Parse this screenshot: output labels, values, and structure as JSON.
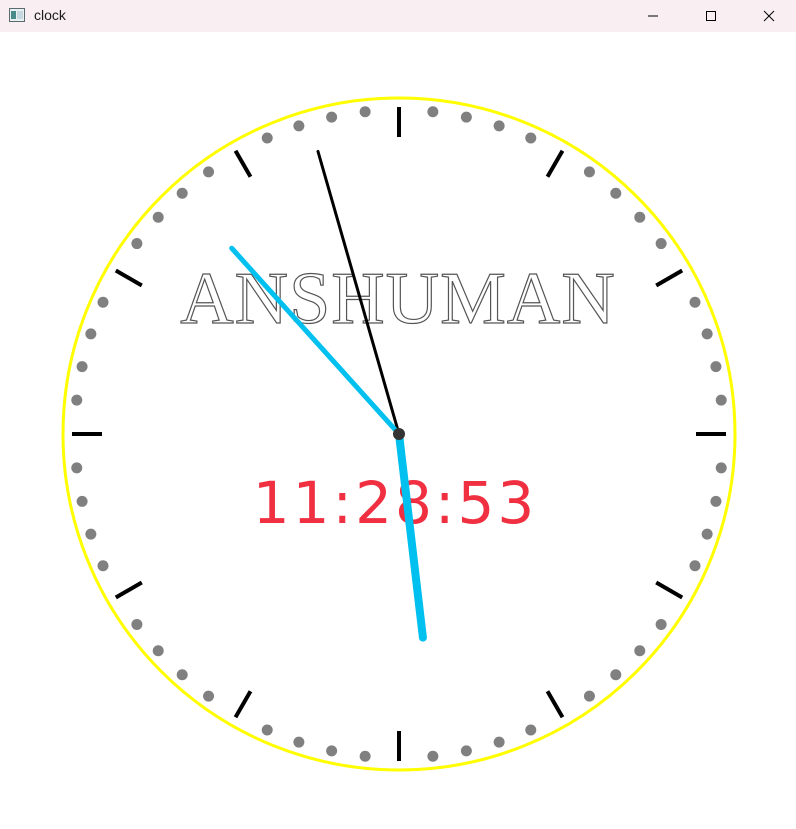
{
  "window": {
    "title": "clock",
    "icons": {
      "app": "app-window-icon",
      "minimize": "minimize-icon",
      "maximize": "maximize-icon",
      "close": "close-icon"
    }
  },
  "clock": {
    "name_text": "ANSHUMAN",
    "digital_time": "11:28:53",
    "time": {
      "hours": 11,
      "minutes": 28,
      "seconds": 53
    },
    "colors": {
      "rim": "#ffff00",
      "hour_marks": "#000000",
      "minute_dots": "#808080",
      "hour_hand": "#000000",
      "minute_hand": "#00c0f0",
      "second_hand": "#00c0f0",
      "center_dot": "#333333",
      "digital_text": "#f03040",
      "name_text": "#555555"
    }
  }
}
